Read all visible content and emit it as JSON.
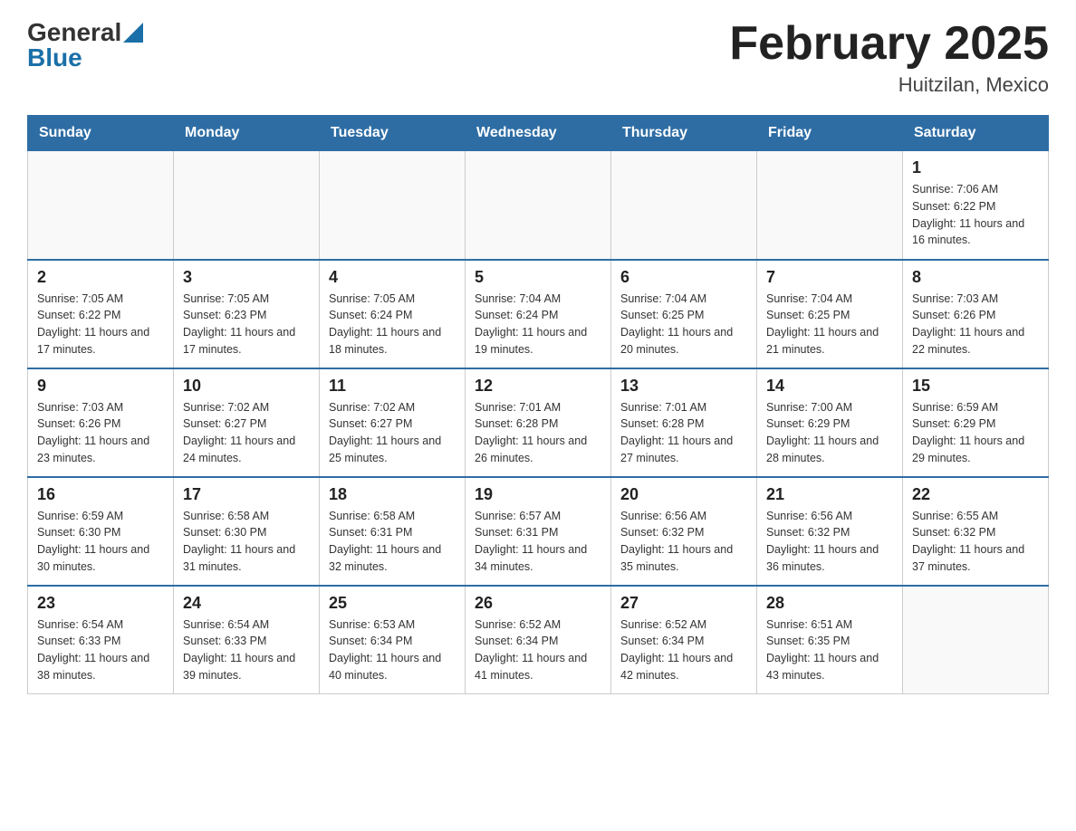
{
  "header": {
    "logo": {
      "general": "General",
      "blue": "Blue"
    },
    "title": "February 2025",
    "subtitle": "Huitzilan, Mexico"
  },
  "weekdays": [
    "Sunday",
    "Monday",
    "Tuesday",
    "Wednesday",
    "Thursday",
    "Friday",
    "Saturday"
  ],
  "weeks": [
    [
      {
        "day": "",
        "sunrise": "",
        "sunset": "",
        "daylight": ""
      },
      {
        "day": "",
        "sunrise": "",
        "sunset": "",
        "daylight": ""
      },
      {
        "day": "",
        "sunrise": "",
        "sunset": "",
        "daylight": ""
      },
      {
        "day": "",
        "sunrise": "",
        "sunset": "",
        "daylight": ""
      },
      {
        "day": "",
        "sunrise": "",
        "sunset": "",
        "daylight": ""
      },
      {
        "day": "",
        "sunrise": "",
        "sunset": "",
        "daylight": ""
      },
      {
        "day": "1",
        "sunrise": "Sunrise: 7:06 AM",
        "sunset": "Sunset: 6:22 PM",
        "daylight": "Daylight: 11 hours and 16 minutes."
      }
    ],
    [
      {
        "day": "2",
        "sunrise": "Sunrise: 7:05 AM",
        "sunset": "Sunset: 6:22 PM",
        "daylight": "Daylight: 11 hours and 17 minutes."
      },
      {
        "day": "3",
        "sunrise": "Sunrise: 7:05 AM",
        "sunset": "Sunset: 6:23 PM",
        "daylight": "Daylight: 11 hours and 17 minutes."
      },
      {
        "day": "4",
        "sunrise": "Sunrise: 7:05 AM",
        "sunset": "Sunset: 6:24 PM",
        "daylight": "Daylight: 11 hours and 18 minutes."
      },
      {
        "day": "5",
        "sunrise": "Sunrise: 7:04 AM",
        "sunset": "Sunset: 6:24 PM",
        "daylight": "Daylight: 11 hours and 19 minutes."
      },
      {
        "day": "6",
        "sunrise": "Sunrise: 7:04 AM",
        "sunset": "Sunset: 6:25 PM",
        "daylight": "Daylight: 11 hours and 20 minutes."
      },
      {
        "day": "7",
        "sunrise": "Sunrise: 7:04 AM",
        "sunset": "Sunset: 6:25 PM",
        "daylight": "Daylight: 11 hours and 21 minutes."
      },
      {
        "day": "8",
        "sunrise": "Sunrise: 7:03 AM",
        "sunset": "Sunset: 6:26 PM",
        "daylight": "Daylight: 11 hours and 22 minutes."
      }
    ],
    [
      {
        "day": "9",
        "sunrise": "Sunrise: 7:03 AM",
        "sunset": "Sunset: 6:26 PM",
        "daylight": "Daylight: 11 hours and 23 minutes."
      },
      {
        "day": "10",
        "sunrise": "Sunrise: 7:02 AM",
        "sunset": "Sunset: 6:27 PM",
        "daylight": "Daylight: 11 hours and 24 minutes."
      },
      {
        "day": "11",
        "sunrise": "Sunrise: 7:02 AM",
        "sunset": "Sunset: 6:27 PM",
        "daylight": "Daylight: 11 hours and 25 minutes."
      },
      {
        "day": "12",
        "sunrise": "Sunrise: 7:01 AM",
        "sunset": "Sunset: 6:28 PM",
        "daylight": "Daylight: 11 hours and 26 minutes."
      },
      {
        "day": "13",
        "sunrise": "Sunrise: 7:01 AM",
        "sunset": "Sunset: 6:28 PM",
        "daylight": "Daylight: 11 hours and 27 minutes."
      },
      {
        "day": "14",
        "sunrise": "Sunrise: 7:00 AM",
        "sunset": "Sunset: 6:29 PM",
        "daylight": "Daylight: 11 hours and 28 minutes."
      },
      {
        "day": "15",
        "sunrise": "Sunrise: 6:59 AM",
        "sunset": "Sunset: 6:29 PM",
        "daylight": "Daylight: 11 hours and 29 minutes."
      }
    ],
    [
      {
        "day": "16",
        "sunrise": "Sunrise: 6:59 AM",
        "sunset": "Sunset: 6:30 PM",
        "daylight": "Daylight: 11 hours and 30 minutes."
      },
      {
        "day": "17",
        "sunrise": "Sunrise: 6:58 AM",
        "sunset": "Sunset: 6:30 PM",
        "daylight": "Daylight: 11 hours and 31 minutes."
      },
      {
        "day": "18",
        "sunrise": "Sunrise: 6:58 AM",
        "sunset": "Sunset: 6:31 PM",
        "daylight": "Daylight: 11 hours and 32 minutes."
      },
      {
        "day": "19",
        "sunrise": "Sunrise: 6:57 AM",
        "sunset": "Sunset: 6:31 PM",
        "daylight": "Daylight: 11 hours and 34 minutes."
      },
      {
        "day": "20",
        "sunrise": "Sunrise: 6:56 AM",
        "sunset": "Sunset: 6:32 PM",
        "daylight": "Daylight: 11 hours and 35 minutes."
      },
      {
        "day": "21",
        "sunrise": "Sunrise: 6:56 AM",
        "sunset": "Sunset: 6:32 PM",
        "daylight": "Daylight: 11 hours and 36 minutes."
      },
      {
        "day": "22",
        "sunrise": "Sunrise: 6:55 AM",
        "sunset": "Sunset: 6:32 PM",
        "daylight": "Daylight: 11 hours and 37 minutes."
      }
    ],
    [
      {
        "day": "23",
        "sunrise": "Sunrise: 6:54 AM",
        "sunset": "Sunset: 6:33 PM",
        "daylight": "Daylight: 11 hours and 38 minutes."
      },
      {
        "day": "24",
        "sunrise": "Sunrise: 6:54 AM",
        "sunset": "Sunset: 6:33 PM",
        "daylight": "Daylight: 11 hours and 39 minutes."
      },
      {
        "day": "25",
        "sunrise": "Sunrise: 6:53 AM",
        "sunset": "Sunset: 6:34 PM",
        "daylight": "Daylight: 11 hours and 40 minutes."
      },
      {
        "day": "26",
        "sunrise": "Sunrise: 6:52 AM",
        "sunset": "Sunset: 6:34 PM",
        "daylight": "Daylight: 11 hours and 41 minutes."
      },
      {
        "day": "27",
        "sunrise": "Sunrise: 6:52 AM",
        "sunset": "Sunset: 6:34 PM",
        "daylight": "Daylight: 11 hours and 42 minutes."
      },
      {
        "day": "28",
        "sunrise": "Sunrise: 6:51 AM",
        "sunset": "Sunset: 6:35 PM",
        "daylight": "Daylight: 11 hours and 43 minutes."
      },
      {
        "day": "",
        "sunrise": "",
        "sunset": "",
        "daylight": ""
      }
    ]
  ]
}
